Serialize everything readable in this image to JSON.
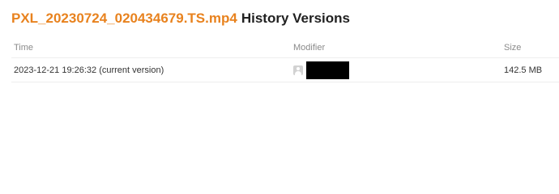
{
  "header": {
    "file_name": "PXL_20230724_020434679.TS.mp4",
    "title_suffix": "History Versions"
  },
  "table": {
    "columns": {
      "time": "Time",
      "modifier": "Modifier",
      "size": "Size"
    },
    "rows": [
      {
        "time": "2023-12-21 19:26:32 (current version)",
        "modifier_icon": "avatar-icon",
        "modifier_name": "",
        "modifier_name_redacted": true,
        "size": "142.5 MB"
      }
    ]
  },
  "colors": {
    "file_link": "#e8821e",
    "heading": "#212121",
    "column_header": "#8a8a8a",
    "row_border": "#eeeeee",
    "redaction": "#000000"
  }
}
